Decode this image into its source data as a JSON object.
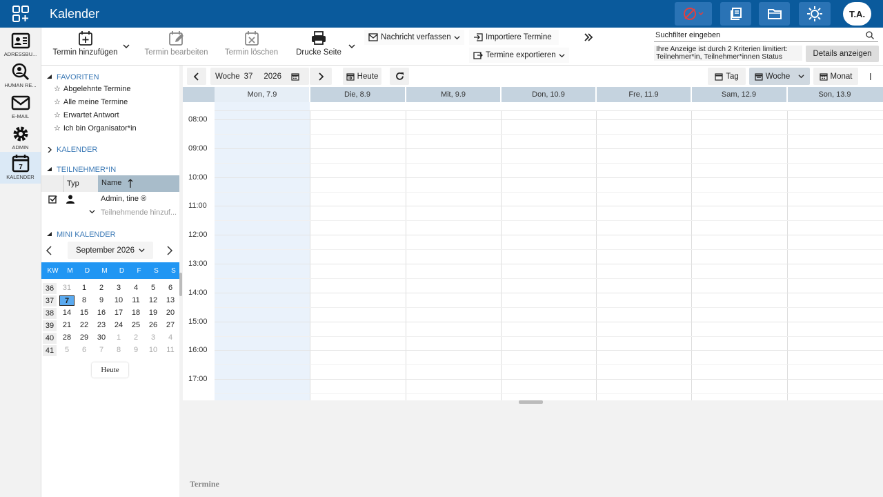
{
  "app": {
    "title": "Kalender",
    "user_initials": "T.A."
  },
  "modules": [
    {
      "label": "ADRESSBU...",
      "icon": "addressbook-icon"
    },
    {
      "label": "HUMAN RE...",
      "icon": "human-resources-icon"
    },
    {
      "label": "E-MAIL",
      "icon": "mail-icon"
    },
    {
      "label": "ADMIN",
      "icon": "gear-icon"
    },
    {
      "label": "KALENDER",
      "icon": "calendar-icon",
      "active": true
    }
  ],
  "toolbar": {
    "add_event": "Termin hinzufügen",
    "edit_event": "Termin bearbeiten",
    "delete_event": "Termin löschen",
    "print_page": "Drucke Seite",
    "compose_message": "Nachricht verfassen",
    "import_events": "Importiere Termine",
    "export_events": "Termine exportieren",
    "search_placeholder": "Suchfilter eingeben",
    "filter_info": "Ihre Anzeige ist durch 2 Kriterien limitiert: Teilnehmer*in, Teilnehmer*innen Status",
    "details_button": "Details anzeigen"
  },
  "favorites": {
    "title": "FAVORITEN",
    "items": [
      "Abgelehnte Termine",
      "Alle meine Termine",
      "Erwartet Antwort",
      "Ich bin Organisator*in"
    ]
  },
  "calendars_section": {
    "title": "KALENDER"
  },
  "attendees": {
    "title": "TEILNEHMER*IN",
    "col_type": "Typ",
    "col_name": "Name",
    "rows": [
      {
        "name": "Admin, tine ®"
      }
    ],
    "add_placeholder": "Teilnehmende hinzuf..."
  },
  "mini_calendar": {
    "title": "MINI KALENDER",
    "month_label": "September 2026",
    "headers": [
      "KW",
      "M",
      "D",
      "M",
      "D",
      "F",
      "S",
      "S"
    ],
    "weeks": [
      {
        "kw": "36",
        "days": [
          "31",
          "1",
          "2",
          "3",
          "4",
          "5",
          "6"
        ],
        "other": [
          true,
          false,
          false,
          false,
          false,
          false,
          false
        ]
      },
      {
        "kw": "37",
        "days": [
          "7",
          "8",
          "9",
          "10",
          "11",
          "12",
          "13"
        ],
        "other": [
          false,
          false,
          false,
          false,
          false,
          false,
          false
        ]
      },
      {
        "kw": "38",
        "days": [
          "14",
          "15",
          "16",
          "17",
          "18",
          "19",
          "20"
        ],
        "other": [
          false,
          false,
          false,
          false,
          false,
          false,
          false
        ]
      },
      {
        "kw": "39",
        "days": [
          "21",
          "22",
          "23",
          "24",
          "25",
          "26",
          "27"
        ],
        "other": [
          false,
          false,
          false,
          false,
          false,
          false,
          false
        ]
      },
      {
        "kw": "40",
        "days": [
          "28",
          "29",
          "30",
          "1",
          "2",
          "3",
          "4"
        ],
        "other": [
          false,
          false,
          false,
          true,
          true,
          true,
          true
        ]
      },
      {
        "kw": "41",
        "days": [
          "5",
          "6",
          "7",
          "8",
          "9",
          "10",
          "11"
        ],
        "other": [
          true,
          true,
          true,
          true,
          true,
          true,
          true
        ]
      }
    ],
    "selected_day": "7",
    "today_button": "Heute"
  },
  "calnav": {
    "week_label": "Woche",
    "week_number": "37",
    "year": "2026",
    "today": "Heute",
    "view_day": "Tag",
    "view_week": "Woche",
    "view_month": "Monat"
  },
  "week": {
    "days": [
      "Mon, 7.9",
      "Die, 8.9",
      "Mit, 9.9",
      "Don, 10.9",
      "Fre, 11.9",
      "Sam, 12.9",
      "Son, 13.9"
    ],
    "hours": [
      "08:00",
      "09:00",
      "10:00",
      "11:00",
      "12:00",
      "13:00",
      "14:00",
      "15:00",
      "16:00",
      "17:00"
    ]
  },
  "bottom": {
    "label": "Termine"
  },
  "colors": {
    "topbar": "#0a5a9c",
    "accent": "#2196f3",
    "selected": "#5aaaf0"
  }
}
